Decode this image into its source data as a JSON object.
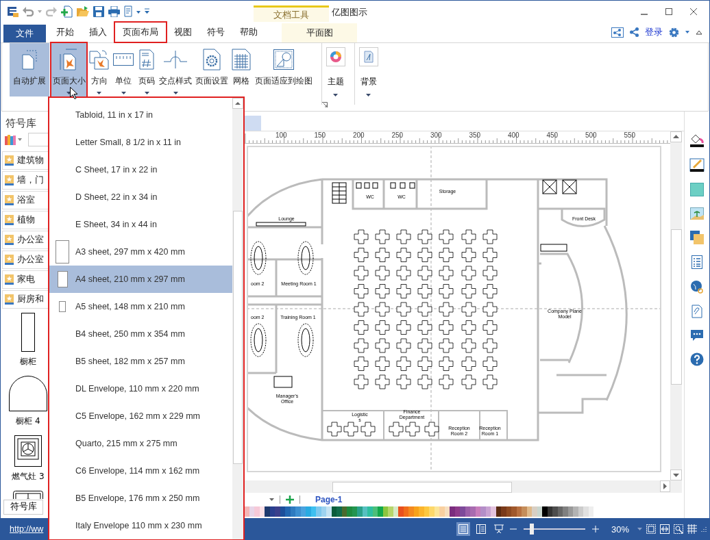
{
  "window": {
    "title": "亿图图示",
    "context_group": "文档工具"
  },
  "menu_tabs": [
    {
      "label": "文件",
      "kind": "file",
      "selected": false,
      "outlined": false
    },
    {
      "label": "开始",
      "kind": "tab",
      "selected": false,
      "outlined": false
    },
    {
      "label": "插入",
      "kind": "tab",
      "selected": false,
      "outlined": false
    },
    {
      "label": "页面布局",
      "kind": "tab",
      "selected": true,
      "outlined": true
    },
    {
      "label": "视图",
      "kind": "tab",
      "selected": false,
      "outlined": false
    },
    {
      "label": "符号",
      "kind": "tab",
      "selected": false,
      "outlined": false
    },
    {
      "label": "帮助",
      "kind": "tab",
      "selected": false,
      "outlined": false
    },
    {
      "label": "平面图",
      "kind": "context",
      "selected": false,
      "outlined": false
    }
  ],
  "account": {
    "login": "登录"
  },
  "ribbon": [
    {
      "label": "自动扩展",
      "kind": "expand",
      "highlighted": true,
      "outlined": false,
      "dropdown": false
    },
    {
      "label": "页面大小",
      "kind": "pagesize",
      "highlighted": true,
      "outlined": true,
      "dropdown": true
    },
    {
      "label": "方向",
      "kind": "orientation",
      "highlighted": false,
      "outlined": false,
      "dropdown": true
    },
    {
      "label": "单位",
      "kind": "units",
      "highlighted": false,
      "outlined": false,
      "dropdown": true
    },
    {
      "label": "页码",
      "kind": "pagenum",
      "highlighted": false,
      "outlined": false,
      "dropdown": true
    },
    {
      "label": "交点样式",
      "kind": "jump",
      "highlighted": false,
      "outlined": false,
      "dropdown": true
    },
    {
      "label": "页面设置",
      "kind": "setup",
      "highlighted": false,
      "outlined": false,
      "dropdown": false
    },
    {
      "label": "网格",
      "kind": "grid",
      "highlighted": false,
      "outlined": false,
      "dropdown": false
    },
    {
      "label": "页面适应到绘图",
      "kind": "fit",
      "highlighted": false,
      "outlined": false,
      "dropdown": false
    }
  ],
  "ribbon_groups": [
    {
      "label": "主题",
      "kind": "theme"
    },
    {
      "label": "背景",
      "kind": "background"
    }
  ],
  "page_size_menu": [
    {
      "label": "Tabloid, 11 in x 17 in",
      "selected": false
    },
    {
      "label": "Letter Small, 8 1/2 in x 11 in",
      "selected": false
    },
    {
      "label": "C Sheet, 17 in x 22 in",
      "selected": false
    },
    {
      "label": "D Sheet, 22 in x 34 in",
      "selected": false
    },
    {
      "label": "E Sheet, 34 in x 44 in",
      "selected": false
    },
    {
      "label": "A3 sheet, 297 mm x 420 mm",
      "selected": false,
      "kind": "large"
    },
    {
      "label": "A4 sheet, 210 mm x 297 mm",
      "selected": true,
      "kind": "medium"
    },
    {
      "label": "A5 sheet, 148 mm x 210 mm",
      "selected": false,
      "kind": "small"
    },
    {
      "label": "B4 sheet, 250 mm x 354 mm",
      "selected": false
    },
    {
      "label": "B5 sheet, 182 mm x 257 mm",
      "selected": false
    },
    {
      "label": "DL Envelope, 110 mm x 220 mm",
      "selected": false
    },
    {
      "label": "C5 Envelope, 162 mm x 229 mm",
      "selected": false
    },
    {
      "label": "Quarto, 215 mm x 275 mm",
      "selected": false
    },
    {
      "label": "C6 Envelope, 114 mm x 162 mm",
      "selected": false
    },
    {
      "label": "B5 Envelope, 176 mm x 250 mm",
      "selected": false
    },
    {
      "label": "Italy Envelope 110 mm x 230 mm",
      "selected": false
    }
  ],
  "library": {
    "title": "符号库",
    "categories": [
      "建筑物",
      "墙，门",
      "浴室",
      "植物",
      "办公室",
      "办公室",
      "家电",
      "厨房和"
    ],
    "shapes": [
      {
        "label": "橱柜",
        "kind": "cabinet"
      },
      {
        "label": "橱柜 4",
        "kind": "arch"
      },
      {
        "label": "燃气灶 3",
        "kind": "stove"
      },
      {
        "kind": "burner"
      }
    ],
    "tab": "符号库"
  },
  "ruler": [
    "100",
    "150",
    "200",
    "250",
    "300",
    "350",
    "400",
    "450",
    "500",
    "550"
  ],
  "floor_plan_labels": [
    {
      "lines": [
        "Storage"
      ]
    },
    {
      "lines": [
        "WC"
      ]
    },
    {
      "lines": [
        "WC"
      ]
    },
    {
      "lines": [
        "Lounge"
      ]
    },
    {
      "lines": [
        "Front Desk"
      ]
    },
    {
      "lines": [
        "oom 2"
      ]
    },
    {
      "lines": [
        "Meeting Room 1"
      ]
    },
    {
      "lines": [
        "oom 2"
      ]
    },
    {
      "lines": [
        "Training Room 1"
      ]
    },
    {
      "lines": [
        "Company Plane",
        "Model"
      ]
    },
    {
      "lines": [
        "Manager's",
        "Office"
      ]
    },
    {
      "lines": [
        "Logistic",
        "s"
      ]
    },
    {
      "lines": [
        "Finance",
        "Department"
      ]
    },
    {
      "lines": [
        "Reception",
        "Room 2"
      ]
    },
    {
      "lines": [
        "Reception",
        "Room 1"
      ]
    }
  ],
  "page_tabs": [
    {
      "label": "Page-1",
      "selected": true
    }
  ],
  "palette": [
    {
      "color": "#f4b6b6"
    },
    {
      "color": "#e8d5e8"
    },
    {
      "color": "#f6c9d8"
    },
    {
      "color": "#fbe0e6"
    },
    {
      "color": "#1f3a6e"
    },
    {
      "color": "#2a3f8f"
    },
    {
      "color": "#3b3f8c"
    },
    {
      "color": "#1d4e9a"
    },
    {
      "color": "#2266b0"
    },
    {
      "color": "#2f7bc0"
    },
    {
      "color": "#3d8fd0"
    },
    {
      "color": "#4aa3df"
    },
    {
      "color": "#29abe2"
    },
    {
      "color": "#3ec0f0"
    },
    {
      "color": "#7dc8ee"
    },
    {
      "color": "#9dd3f0"
    },
    {
      "color": "#c5e3f3"
    },
    {
      "color": "#0b5c3b"
    },
    {
      "color": "#116b4a"
    },
    {
      "color": "#4a6b2e"
    },
    {
      "color": "#1e8a3e"
    },
    {
      "color": "#23954f"
    },
    {
      "color": "#2aa18a"
    },
    {
      "color": "#56c0c0"
    },
    {
      "color": "#2fbfa0"
    },
    {
      "color": "#4cbf7a"
    },
    {
      "color": "#13a84b"
    },
    {
      "color": "#8cc63f"
    },
    {
      "color": "#b7d66b"
    },
    {
      "color": "#d7e9c5"
    },
    {
      "color": "#e8501e"
    },
    {
      "color": "#f06c1a"
    },
    {
      "color": "#f4891f"
    },
    {
      "color": "#f7a21b"
    },
    {
      "color": "#fbb52c"
    },
    {
      "color": "#fdc840"
    },
    {
      "color": "#fdd86a"
    },
    {
      "color": "#fce598"
    },
    {
      "color": "#f9d0a0"
    },
    {
      "color": "#f7dfc0"
    },
    {
      "color": "#7b2d7e"
    },
    {
      "color": "#8e3a8a"
    },
    {
      "color": "#7d4a9a"
    },
    {
      "color": "#9b5fa8"
    },
    {
      "color": "#a86bb0"
    },
    {
      "color": "#c77dbb"
    },
    {
      "color": "#b48ec8"
    },
    {
      "color": "#c9a2d2"
    },
    {
      "color": "#e3c3df"
    },
    {
      "color": "#5a2a12"
    },
    {
      "color": "#7a3a1a"
    },
    {
      "color": "#8e4a22"
    },
    {
      "color": "#a0582c"
    },
    {
      "color": "#b87040"
    },
    {
      "color": "#c58d5a"
    },
    {
      "color": "#dfb98a"
    },
    {
      "color": "#d8cfc4"
    },
    {
      "color": "#c9d6cf"
    },
    {
      "color": "#000000"
    },
    {
      "color": "#333333"
    },
    {
      "color": "#4d4d4d"
    },
    {
      "color": "#666666"
    },
    {
      "color": "#808080"
    },
    {
      "color": "#999999"
    },
    {
      "color": "#b3b3b3"
    },
    {
      "color": "#cccccc"
    },
    {
      "color": "#e0e0e0"
    },
    {
      "color": "#eeeeee"
    }
  ],
  "status_bar": {
    "link": "http://ww",
    "views": [
      {
        "kind": "page",
        "selected": true
      },
      {
        "kind": "outline",
        "selected": false
      },
      {
        "kind": "present",
        "selected": false
      }
    ],
    "zoom": {
      "level": 0.1,
      "reading": "30%"
    }
  }
}
